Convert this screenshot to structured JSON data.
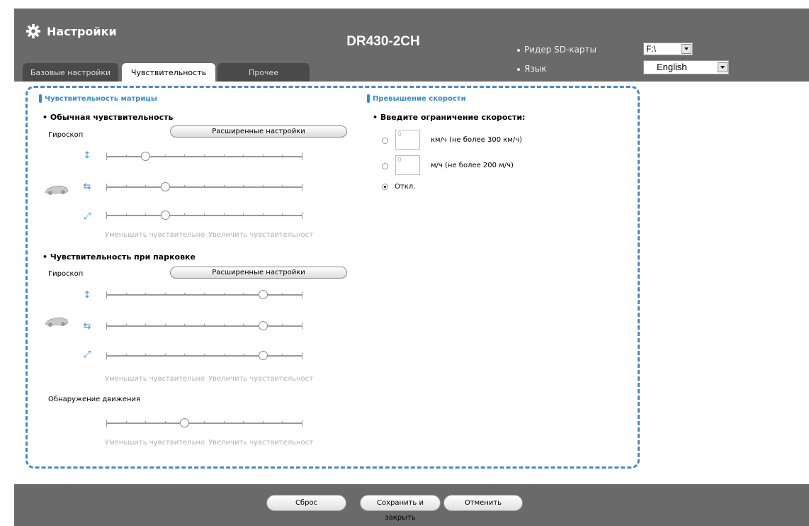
{
  "header": {
    "title": "Настройки",
    "model": "DR430-2CH",
    "sd_reader_label": "Ридер SD-карты",
    "sd_reader_value": "F:\\",
    "language_label": "Язык",
    "language_value": "English"
  },
  "tabs": [
    {
      "label": "Базовые настройки",
      "active": false
    },
    {
      "label": "Чувствительность",
      "active": true
    },
    {
      "label": "Прочее",
      "active": false
    }
  ],
  "sensitivity": {
    "section_title": "Чувствительность матрицы",
    "normal": {
      "heading": "Обычная чувствительность",
      "gyro_label": "Гироскоп",
      "advanced_button": "Расширенные настройки",
      "sliders": [
        {
          "axis_icon": "vertical-arrows-icon",
          "level": 0.2
        },
        {
          "axis_icon": "horizontal-arrows-icon",
          "level": 0.3
        },
        {
          "axis_icon": "diagonal-arrows-icon",
          "level": 0.3
        }
      ],
      "decrease_label": "Уменьшить чувствительно",
      "increase_label": "Увеличить чувствительност"
    },
    "parking": {
      "heading": "Чувствительность при парковке",
      "gyro_label": "Гироскоп",
      "advanced_button": "Расширенные настройки",
      "sliders": [
        {
          "axis_icon": "vertical-arrows-icon",
          "level": 0.8
        },
        {
          "axis_icon": "horizontal-arrows-icon",
          "level": 0.8
        },
        {
          "axis_icon": "diagonal-arrows-icon",
          "level": 0.8
        }
      ],
      "decrease_label": "Уменьшить чувствительно",
      "increase_label": "Увеличить чувствительност"
    },
    "motion": {
      "label": "Обнаружение движения",
      "level": 0.4,
      "decrease_label": "Уменьшить чувствительно",
      "increase_label": "Увеличить чувствительност"
    }
  },
  "speed": {
    "section_title": "Превышение скорости",
    "heading": "Введите ограничение скорости:",
    "options": [
      {
        "value": "0",
        "label": "км/ч (не более 300 км/ч)",
        "selected": false
      },
      {
        "value": "0",
        "label": "м/ч (не более 200 м/ч)",
        "selected": false
      },
      {
        "value": "",
        "label": "Откл.",
        "selected": true
      }
    ]
  },
  "footer": {
    "reset": "Сброс",
    "save_close": "Сохранить и закрыть",
    "cancel": "Отменить"
  },
  "colors": {
    "header_bg": "#6a6a6a",
    "accent": "#3a8ad0",
    "panel_border": "#4a86c8"
  }
}
